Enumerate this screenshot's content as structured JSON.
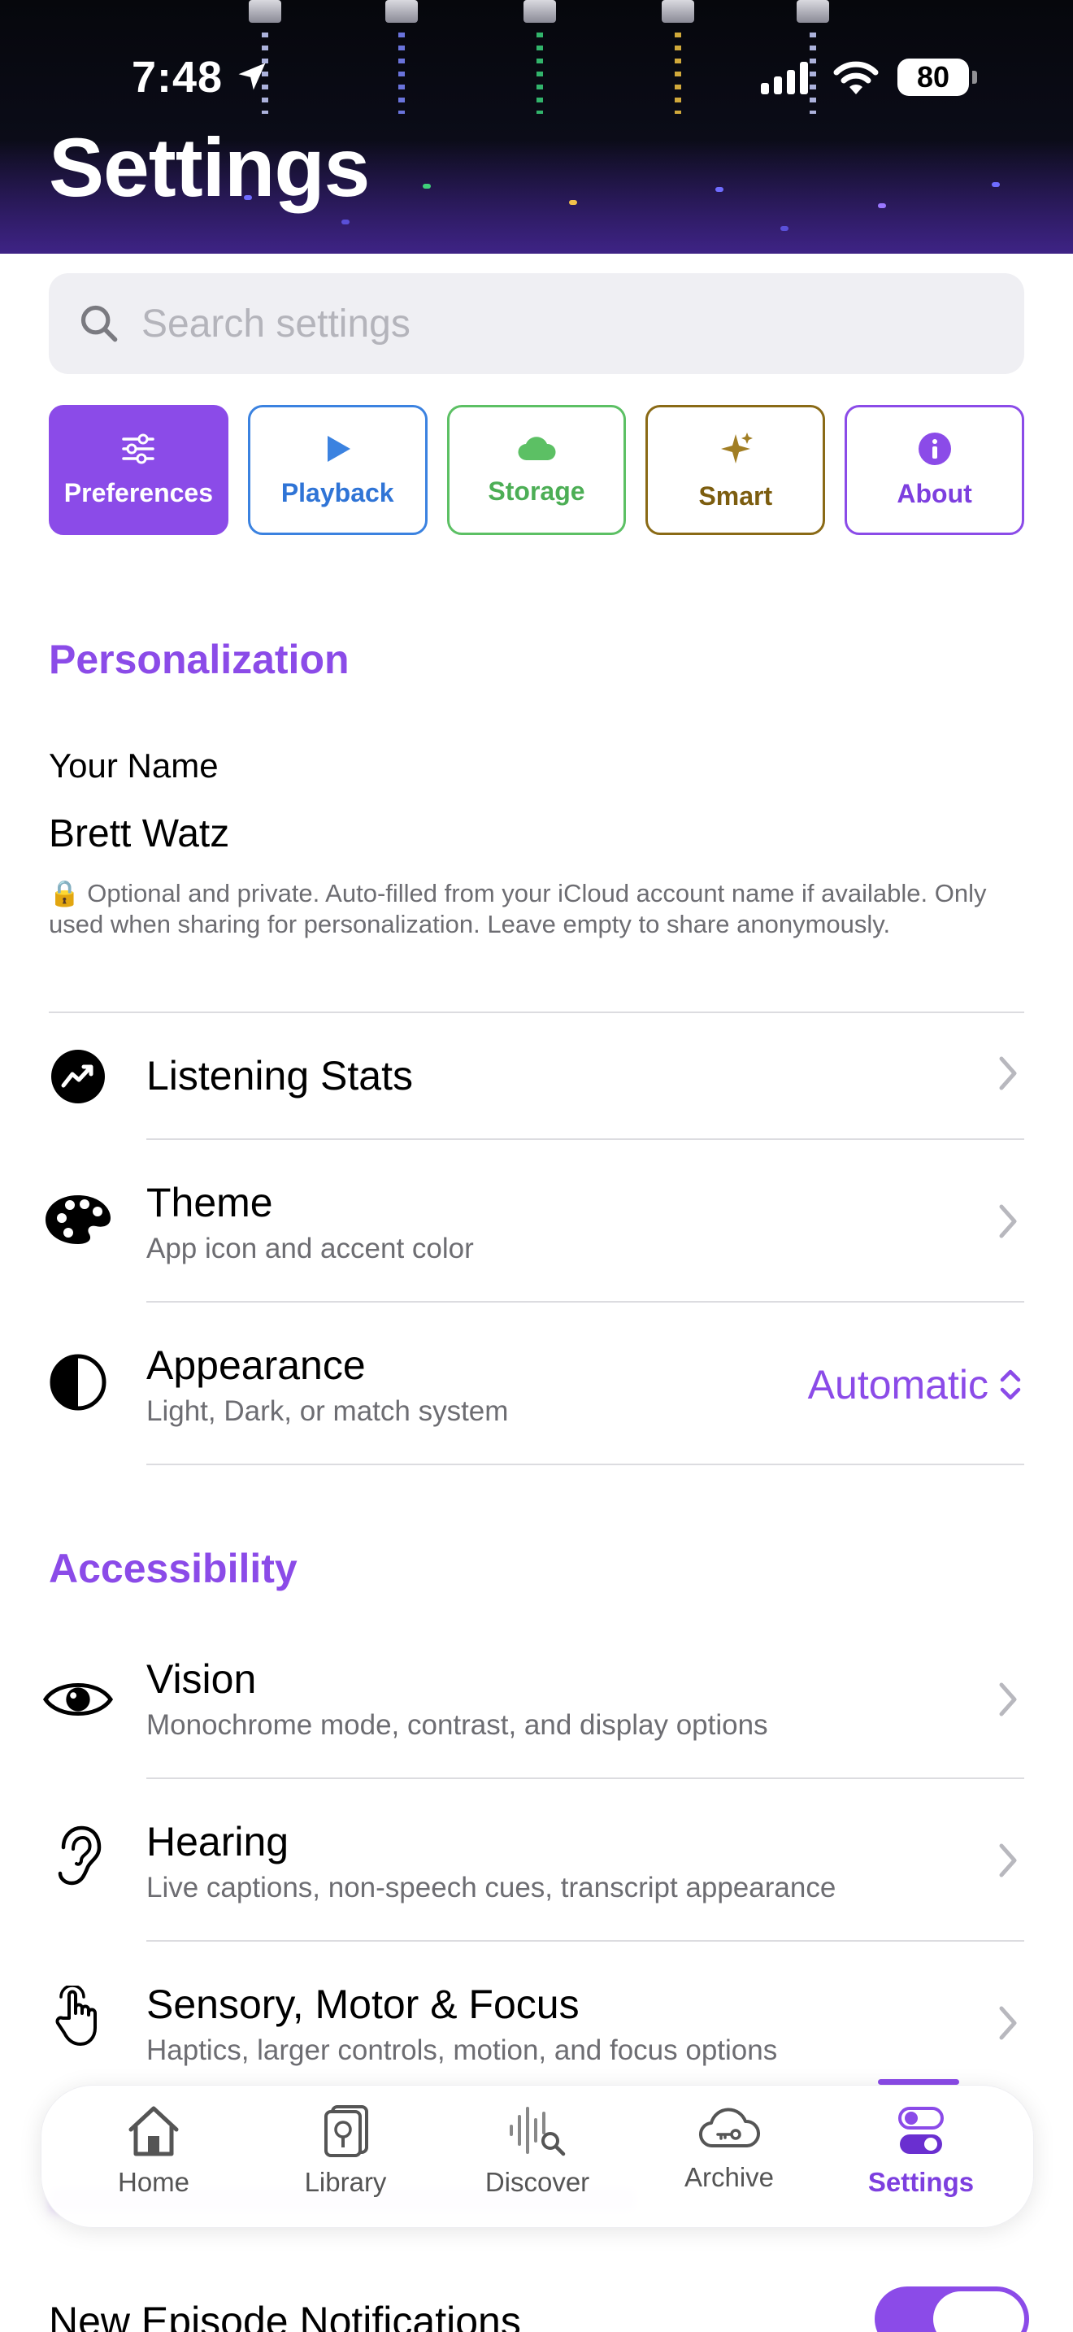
{
  "status_bar": {
    "time": "7:48",
    "battery": "80"
  },
  "page_title": "Settings",
  "search": {
    "placeholder": "Search settings"
  },
  "categories": [
    {
      "label": "Preferences",
      "icon": "sliders-icon",
      "color": "#8b4be8",
      "selected": true
    },
    {
      "label": "Playback",
      "icon": "play-icon",
      "color": "#3b82e0"
    },
    {
      "label": "Storage",
      "icon": "cloud-icon",
      "color": "#5cc064"
    },
    {
      "label": "Smart",
      "icon": "sparkles-icon",
      "color": "#8a6a16"
    },
    {
      "label": "About",
      "icon": "info-icon",
      "color": "#8b4be8"
    }
  ],
  "personalization": {
    "heading": "Personalization",
    "name_label": "Your Name",
    "name_value": "Brett Watz",
    "name_help": "🔒 Optional and private. Auto-filled from your iCloud account name if available. Only used when sharing for personalization. Leave empty to share anonymously.",
    "rows": [
      {
        "title": "Listening Stats",
        "icon": "chart-icon"
      },
      {
        "title": "Theme",
        "subtitle": "App icon and accent color",
        "icon": "palette-icon"
      },
      {
        "title": "Appearance",
        "subtitle": "Light, Dark, or match system",
        "value": "Automatic",
        "icon": "contrast-icon"
      }
    ]
  },
  "accessibility": {
    "heading": "Accessibility",
    "rows": [
      {
        "title": "Vision",
        "subtitle": "Monochrome mode, contrast, and display options",
        "icon": "eye-icon"
      },
      {
        "title": "Hearing",
        "subtitle": "Live captions, non-speech cues, transcript appearance",
        "icon": "ear-icon"
      },
      {
        "title": "Sensory, Motor & Focus",
        "subtitle": "Haptics, larger controls, motion, and focus options",
        "icon": "hand-tap-icon"
      }
    ]
  },
  "notifications": {
    "label": "New Episode Notifications",
    "enabled": true
  },
  "tabbar": {
    "tabs": [
      {
        "label": "Home",
        "icon": "house-icon"
      },
      {
        "label": "Library",
        "icon": "library-icon"
      },
      {
        "label": "Discover",
        "icon": "waveform-search-icon"
      },
      {
        "label": "Archive",
        "icon": "cloud-key-icon"
      },
      {
        "label": "Settings",
        "icon": "toggles-icon",
        "selected": true
      }
    ]
  },
  "colors": {
    "accent": "#8b4be8",
    "secondary_text": "#6d6d72",
    "divider": "#dcdce0"
  }
}
